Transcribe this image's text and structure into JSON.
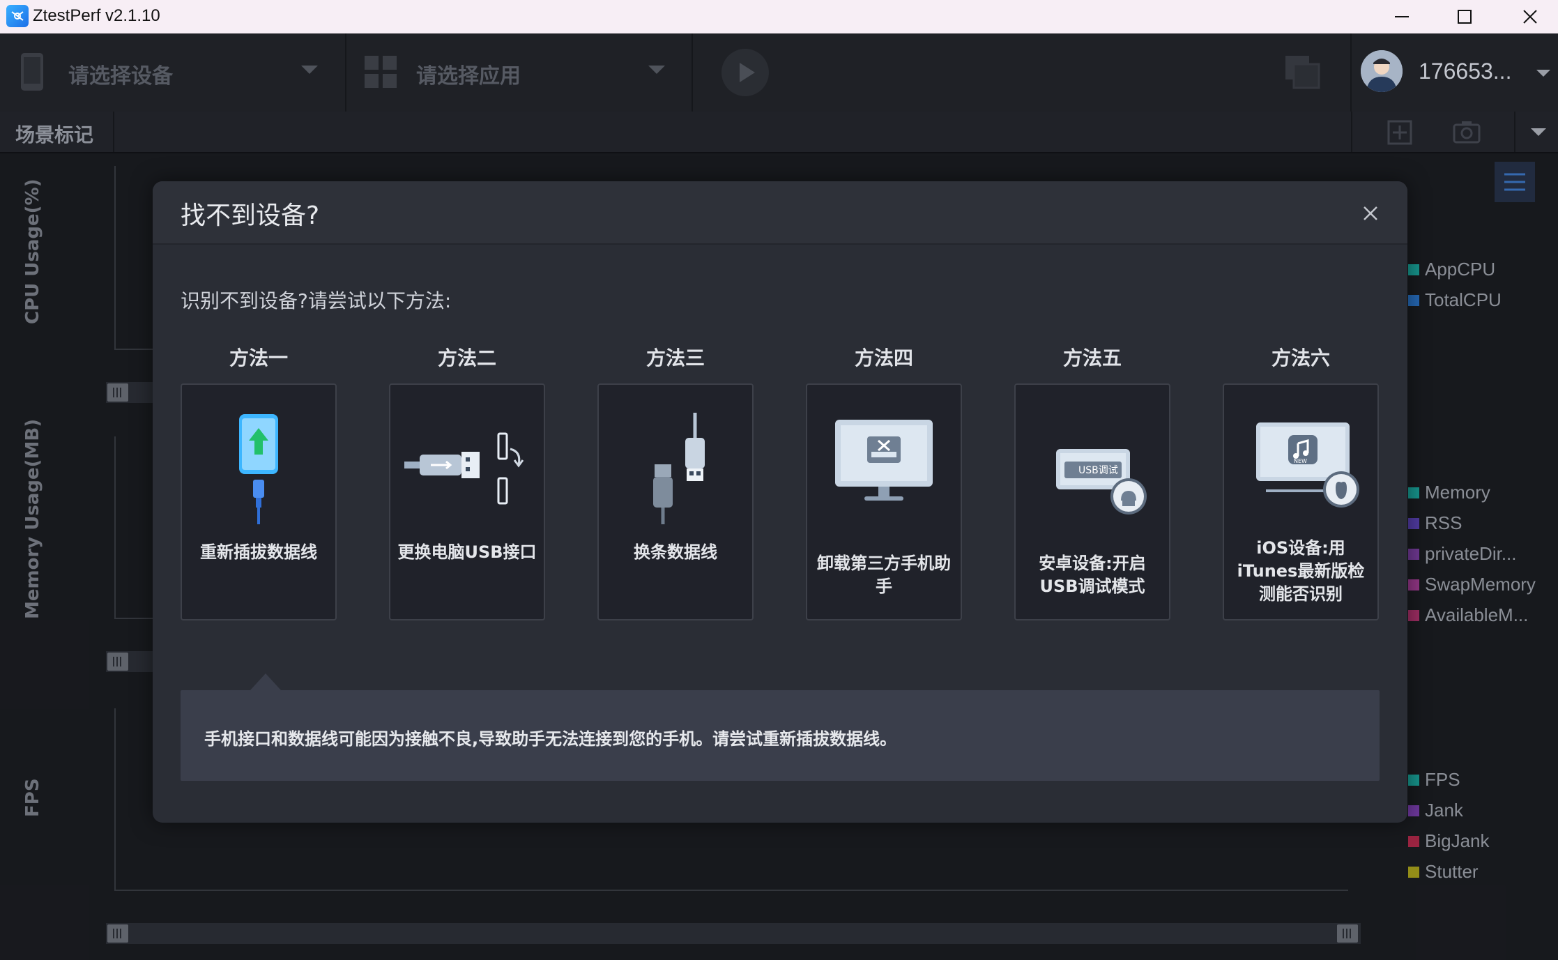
{
  "window": {
    "title": "ZtestPerf v2.1.10"
  },
  "toolbar": {
    "device_placeholder": "请选择设备",
    "app_placeholder": "请选择应用",
    "user_name": "176653..."
  },
  "scene": {
    "label": "场景标记"
  },
  "charts": [
    {
      "ylabel": "CPU Usage(%)",
      "legend": [
        {
          "name": "AppCPU",
          "color": "#1aa59c"
        },
        {
          "name": "TotalCPU",
          "color": "#2a74c8"
        }
      ]
    },
    {
      "ylabel": "Memory Usage(MB)",
      "legend": [
        {
          "name": "Memory",
          "color": "#1aa59c"
        },
        {
          "name": "RSS",
          "color": "#5b43b5"
        },
        {
          "name": "privateDir...",
          "color": "#7c3fa3"
        },
        {
          "name": "SwapMemory",
          "color": "#a23d95"
        },
        {
          "name": "AvailableM...",
          "color": "#b0336e"
        }
      ]
    },
    {
      "ylabel": "FPS",
      "legend": [
        {
          "name": "FPS",
          "color": "#1aa59c"
        },
        {
          "name": "Jank",
          "color": "#7c3fb0"
        },
        {
          "name": "BigJank",
          "color": "#b02a4a"
        },
        {
          "name": "Stutter",
          "color": "#a8a11c"
        }
      ]
    }
  ],
  "dialog": {
    "title": "找不到设备?",
    "intro": "识别不到设备?请尝试以下方法:",
    "methods": [
      {
        "title": "方法一",
        "label": "重新插拔数据线",
        "icon": "phone-replug-icon"
      },
      {
        "title": "方法二",
        "label": "更换电脑USB接口",
        "icon": "usb-port-icon"
      },
      {
        "title": "方法三",
        "label": "换条数据线",
        "icon": "usb-cable-icon"
      },
      {
        "title": "方法四",
        "label": "卸载第三方手机助手",
        "icon": "uninstall-monitor-icon"
      },
      {
        "title": "方法五",
        "label": "安卓设备:开启USB调试模式",
        "icon": "android-usb-debug-icon",
        "badge": "USB调试"
      },
      {
        "title": "方法六",
        "label": "iOS设备:用iTunes最新版检测能否识别",
        "icon": "itunes-apple-icon",
        "badge": "NEW"
      }
    ],
    "tip": "手机接口和数据线可能因为接触不良,导致助手无法连接到您的手机。请尝试重新插拔数据线。"
  }
}
